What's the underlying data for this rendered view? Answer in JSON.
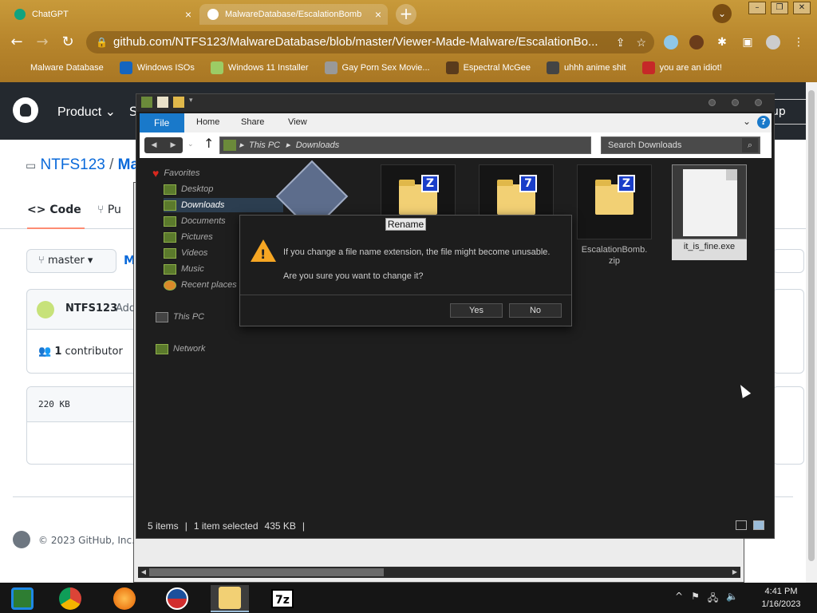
{
  "browser": {
    "tabs": [
      {
        "label": "ChatGPT",
        "color": "#10a37f"
      },
      {
        "label": "MalwareDatabase/EscalationBomb",
        "color": "#ffffff"
      }
    ],
    "new_tab": "+",
    "url": "github.com/NTFS123/MalwareDatabase/blob/master/Viewer-Made-Malware/EscalationBo...",
    "bookmarks": [
      {
        "label": "Malware Database"
      },
      {
        "label": "Windows ISOs"
      },
      {
        "label": "Windows 11 Installer"
      },
      {
        "label": "Gay Porn Sex Movie..."
      },
      {
        "label": "Espectral McGee"
      },
      {
        "label": "uhhh anime shit"
      },
      {
        "label": "you are an idiot!"
      }
    ]
  },
  "github": {
    "nav_product": "Product",
    "nav_s": "S",
    "signup": "up",
    "owner": "NTFS123",
    "separator": "/",
    "repo_partial": "Ma",
    "tab_code": "Code",
    "tab_pull": "Pu",
    "branch": "master",
    "path_partial": "M",
    "commit_user": "NTFS123",
    "commit_action": "Add",
    "contributors_count": "1",
    "contributors_label": "contributor",
    "file_size": "220 KB",
    "footer": "© 2023 GitHub, Inc."
  },
  "explorer": {
    "ribbon": {
      "file": "File",
      "home": "Home",
      "share": "Share",
      "view": "View",
      "help": "?"
    },
    "address": {
      "root": "This PC",
      "folder": "Downloads"
    },
    "search_placeholder": "Search Downloads",
    "nav_pane": {
      "favorites": "Favorites",
      "desktop": "Desktop",
      "downloads": "Downloads",
      "documents": "Documents",
      "pictures": "Pictures",
      "videos": "Videos",
      "music": "Music",
      "recent": "Recent places",
      "this_pc": "This PC",
      "network": "Network"
    },
    "files": [
      {
        "label": "",
        "badge": ""
      },
      {
        "label": "",
        "badge": "Z"
      },
      {
        "label": "",
        "badge": "7"
      },
      {
        "label": "EscalationBomb.\nzip",
        "badge": "Z"
      },
      {
        "label": "it_is_fine.exe",
        "badge": ""
      }
    ],
    "status": {
      "count": "5 items",
      "selected": "1 item selected",
      "size": "435 KB",
      "sep": "|"
    }
  },
  "dialog": {
    "title": "Rename",
    "message1": "If you change a file name extension, the file might become unusable.",
    "message2": "Are you sure you want to change it?",
    "yes": "Yes",
    "no": "No"
  },
  "taskbar": {
    "time": "4:41 PM",
    "date": "1/16/2023",
    "sevenzip": "7z"
  }
}
